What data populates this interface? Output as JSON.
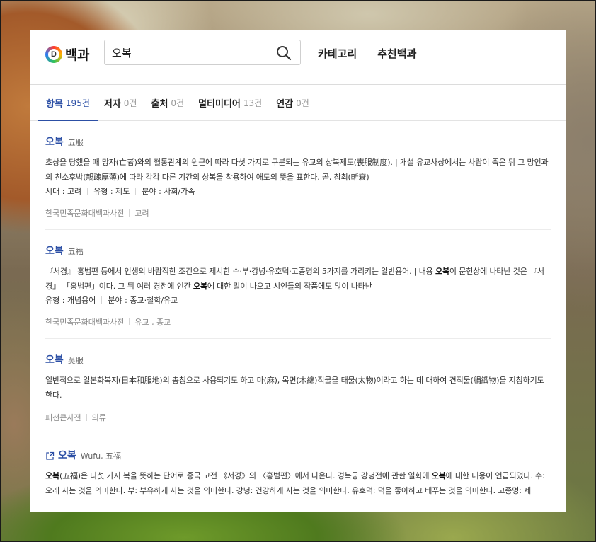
{
  "header": {
    "logo_glyph": "D",
    "logo_text": "백과",
    "search_value": "오복",
    "nav": [
      "카테고리",
      "추천백과"
    ]
  },
  "tabs": [
    {
      "label": "항목",
      "count": "195건",
      "active": true
    },
    {
      "label": "저자",
      "count": "0건"
    },
    {
      "label": "출처",
      "count": "0건"
    },
    {
      "label": "멀티미디어",
      "count": "13건"
    },
    {
      "label": "연감",
      "count": "0건"
    }
  ],
  "results": [
    {
      "title": "오복",
      "subtitle": "五服",
      "desc_parts": [
        {
          "text": "초상을 당했을 때 망자(亡者)와의 혈통관계의 원근에 따라 다섯 가지로 구분되는 유교의 상복제도(喪服制度). | 개설 유교사상에서는 사람이 죽은 뒤 그 망인과의 친소후박(親疎厚薄)에 따라 각각 다른 기간의 상복을 착용하여 애도의 뜻을 표한다. 곧, 참최(斬衰)"
        }
      ],
      "meta": [
        "시대 : 고려",
        "유형 : 제도",
        "분야 : 사회/가족"
      ],
      "source": [
        "한국민족문화대백과사전",
        "고려"
      ]
    },
    {
      "title": "오복",
      "subtitle": "五福",
      "desc_parts": [
        {
          "text": "『서경』 홍범편 등에서 인생의 바람직한 조건으로 제시한 수·부·강녕·유호덕·고종명의 5가지를 가리키는 일반용어. | 내용 "
        },
        {
          "text": "오복",
          "bold": true
        },
        {
          "text": "이 문헌상에 나타난 것은 『서경』 「홍범편」이다. 그 뒤 여러 경전에 인간 "
        },
        {
          "text": "오복",
          "bold": true
        },
        {
          "text": "에 대한 말이 나오고 시인들의 작품에도 많이 나타난"
        }
      ],
      "meta": [
        "유형 : 개념용어",
        "분야 : 종교·철학/유교"
      ],
      "source": [
        "한국민족문화대백과사전",
        "유교 , 종교"
      ]
    },
    {
      "title": "오복",
      "subtitle": "吳服",
      "desc_parts": [
        {
          "text": "일반적으로 일본화복지(日本和服地)의 총칭으로 사용되기도 하고 마(麻), 목면(木綿)직물을 태물(太物)이라고 하는 데 대하여 견직물(絹織物)을 지칭하기도 한다."
        }
      ],
      "meta": [],
      "source": [
        "패션큰사전",
        "의류"
      ]
    },
    {
      "title": "오복",
      "subtitle": "Wufu, 五福",
      "external": true,
      "desc_parts": [
        {
          "text": "오복",
          "bold": true
        },
        {
          "text": "(五福)은 다섯 가지 복을 뜻하는 단어로 중국 고전 《서경》의 〈홍범편〉에서 나온다. 경복궁 강녕전에 관한 일화에 "
        },
        {
          "text": "오복",
          "bold": true
        },
        {
          "text": "에 대한 내용이 언급되었다. 수: 오래 사는 것을 의미한다. 부: 부유하게 사는 것을 의미한다. 강녕: 건강하게 사는 것을 의미한다. 유호덕: 덕을 좋아하고 베푸는 것을 의미한다. 고종명: 제"
        }
      ],
      "meta": [],
      "source": []
    }
  ],
  "colors": {
    "accent": "#2c4fa5"
  }
}
